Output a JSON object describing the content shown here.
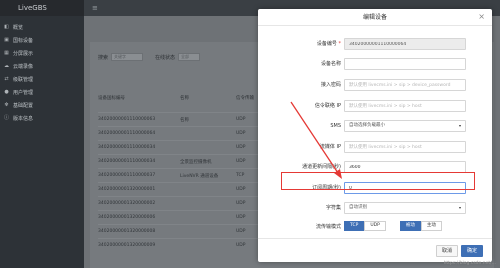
{
  "app": {
    "brand": "LiveGBS",
    "menu_icon": "menu-icon"
  },
  "sidebar": {
    "items": [
      {
        "label": "概览",
        "icon": "dashboard-icon"
      },
      {
        "label": "国标设备",
        "icon": "device-icon"
      },
      {
        "label": "分屏展示",
        "icon": "grid-icon"
      },
      {
        "label": "云端录像",
        "icon": "cloud-icon"
      },
      {
        "label": "级联管理",
        "icon": "share-icon"
      },
      {
        "label": "用户管理",
        "icon": "user-icon"
      },
      {
        "label": "基础配置",
        "icon": "gear-icon"
      },
      {
        "label": "版本信息",
        "icon": "info-icon"
      }
    ]
  },
  "background": {
    "filter_label": "搜索",
    "filter_placeholder": "关键字",
    "filter2_label": "在线状态",
    "filter2_value": "全部",
    "columns": [
      "设备国标编号",
      "名称",
      "信令传输"
    ],
    "rows": [
      [
        "34020000001110000063",
        "名称",
        "UDP"
      ],
      [
        "34020000001110000064",
        "",
        "UDP"
      ],
      [
        "34020000001110000034",
        "",
        "UDP"
      ],
      [
        "34020000001110000034",
        "全景监控摄像机",
        "UDP"
      ],
      [
        "34020000001110000037",
        "LiveNVR 通道设备",
        "TCP"
      ],
      [
        "34020000001320000001",
        "",
        "UDP"
      ],
      [
        "34020000001320000002",
        "",
        "UDP"
      ],
      [
        "34020000001320000006",
        "",
        "UDP"
      ],
      [
        "34020000001320000008",
        "",
        "UDP"
      ],
      [
        "34020000001320000009",
        "",
        "UDP"
      ]
    ]
  },
  "modal": {
    "title": "编辑设备",
    "close_icon": "close-icon",
    "fields": {
      "device_id_label": "设备编号",
      "device_id_value": "34020000001110000064",
      "name_label": "设备名称",
      "name_value": "",
      "password_label": "接入密码",
      "password_placeholder": "默认使用 livecms.ini > sip > device_password",
      "ip_label": "信令联络 IP",
      "ip_placeholder": "默认使用 livecms.ini > sip > host",
      "sms_label": "SMS",
      "sms_value": "自动选择负载最小",
      "media_ip_label": "流媒体 IP",
      "media_ip_placeholder": "默认使用 livecms.ini > sip > host",
      "update_label": "通道更新间隔(秒)",
      "update_value": "3600",
      "subscribe_label": "订阅周期(秒)",
      "subscribe_value": "0",
      "charset_label": "字符集",
      "charset_value": "自动识别",
      "stream_mode_label": "流传输模式",
      "stream_options": [
        "TCP",
        "UDP"
      ],
      "stream_selected": "TCP",
      "active_options": [
        "被动",
        "主动"
      ],
      "active_selected": "被动"
    },
    "cancel_label": "取消",
    "ok_label": "确定"
  },
  "watermark": "https://blog.csdn.net/...",
  "colors": {
    "accent": "#3e6fb5",
    "annotation": "#e53935",
    "sidebar_bg": "#2d3237"
  }
}
